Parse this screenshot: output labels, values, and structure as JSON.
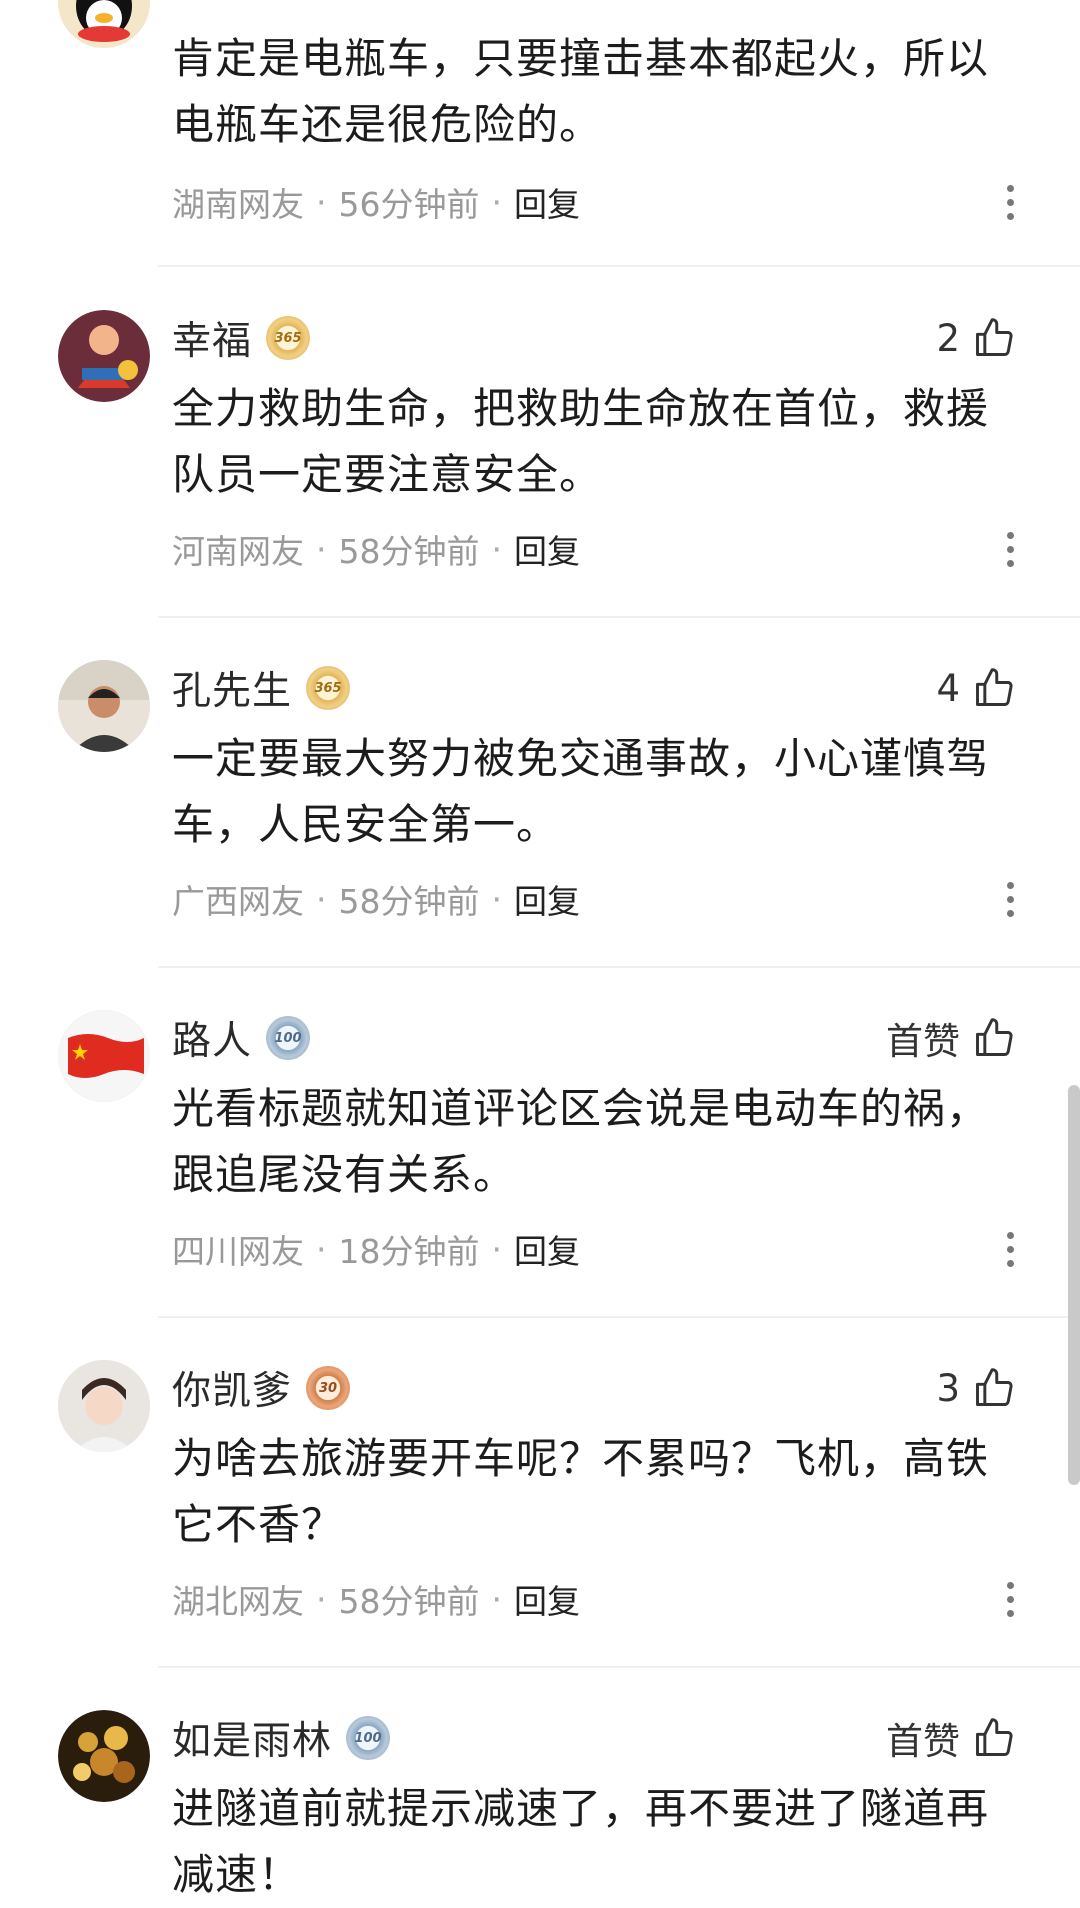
{
  "comments": [
    {
      "username": "",
      "badge": "",
      "like_count": "",
      "text": "肯定是电瓶车，只要撞击基本都起火，所以电瓶车还是很危险的。",
      "region": "湖南网友",
      "time": "56分钟前",
      "reply_label": "回复"
    },
    {
      "username": "幸福",
      "badge": "365",
      "like_count": "2",
      "text": "全力救助生命，把救助生命放在首位，救援队员一定要注意安全。",
      "region": "河南网友",
      "time": "58分钟前",
      "reply_label": "回复"
    },
    {
      "username": "孔先生",
      "badge": "365",
      "like_count": "4",
      "text": "一定要最大努力被免交通事故，小心谨慎驾车，人民安全第一。",
      "region": "广西网友",
      "time": "58分钟前",
      "reply_label": "回复"
    },
    {
      "username": "路人",
      "badge": "100",
      "like_count": "首赞",
      "text": "光看标题就知道评论区会说是电动车的祸，跟追尾没有关系。",
      "region": "四川网友",
      "time": "18分钟前",
      "reply_label": "回复"
    },
    {
      "username": "你凯爹",
      "badge": "30",
      "like_count": "3",
      "text": "为啥去旅游要开车呢？不累吗？飞机，高铁它不香？",
      "region": "湖北网友",
      "time": "58分钟前",
      "reply_label": "回复"
    },
    {
      "username": "如是雨林",
      "badge": "100",
      "like_count": "首赞",
      "text": "进隧道前就提示减速了，再不要进了隧道再减速！",
      "region": "",
      "time": "",
      "reply_label": ""
    }
  ],
  "meta_separator": "·",
  "icons": {
    "like": "thumbs-up-icon",
    "more": "more-vertical-icon"
  },
  "colors": {
    "meta_text": "#999999",
    "body_text": "#1c1c1c",
    "divider": "#f0f0f0"
  }
}
